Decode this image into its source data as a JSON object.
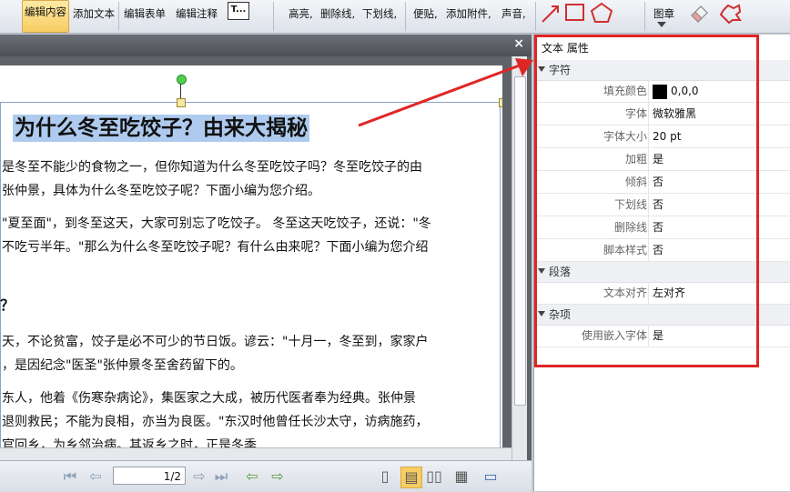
{
  "toolbar": {
    "edit_content": "编辑内容",
    "add_text": "添加文本",
    "edit_form": "编辑表单",
    "edit_annotation": "编辑注释",
    "highlight": "高亮,",
    "strikeout": "删除线,",
    "underline": "下划线,",
    "sticky_note": "便贴,",
    "add_attachment": "添加附件,",
    "sound": "声音,",
    "stamp": "图章",
    "text_icon_glyph": "T..."
  },
  "document": {
    "title": "为什么冬至吃饺子？由来大揭秘",
    "paragraphs": [
      "是冬至不能少的食物之一，但你知道为什么冬至吃饺子吗？冬至吃饺子的由",
      "张仲景，具体为什么冬至吃饺子呢？下面小编为您介绍。",
      "\"夏至面\"，到冬至这天，大家可别忘了吃饺子。 冬至这天吃饺子，还说：\"冬",
      "不吃亏半年。\"那么为什么冬至吃饺子呢？有什么由来呢？下面小编为您介绍",
      "？",
      "天，不论贫富，饺子是必不可少的节日饭。谚云：\"十月一，冬至到，家家户",
      "，是因纪念\"医圣\"张仲景冬至舍药留下的。",
      "东人，他着《伤寒杂病论》，集医家之大成，被历代医者奉为经典。张仲景",
      "退则救民；不能为良相，亦当为良医。\"东汉时他曾任长沙太守，访病施药，",
      "官回乡，为乡邻治病。其返乡之时，正是冬季"
    ],
    "close_glyph": "×"
  },
  "nav": {
    "page_indicator": "1/2"
  },
  "properties": {
    "title": "文本 属性",
    "categories": {
      "character": "字符",
      "paragraph": "段落",
      "misc": "杂项"
    },
    "rows": {
      "fill_color_label": "填充颜色",
      "fill_color_value": "0,0,0",
      "font_label": "字体",
      "font_value": "微软雅黑",
      "font_size_label": "字体大小",
      "font_size_value": "20 pt",
      "bold_label": "加粗",
      "bold_value": "是",
      "italic_label": "倾斜",
      "italic_value": "否",
      "underline_label": "下划线",
      "underline_value": "否",
      "strike_label": "删除线",
      "strike_value": "否",
      "script_label": "脚本样式",
      "script_value": "否",
      "align_label": "文本对齐",
      "align_value": "左对齐",
      "embed_label": "使用嵌入字体",
      "embed_value": "是"
    }
  },
  "colors": {
    "highlight_box": "#e02525",
    "title_selection": "#aecbef",
    "active_tool": "#f7cd62"
  }
}
